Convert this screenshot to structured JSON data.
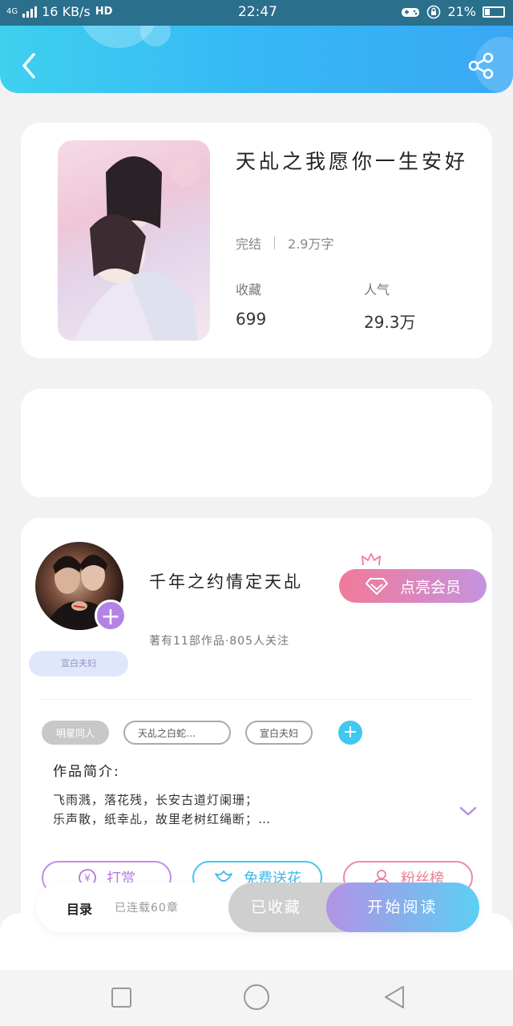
{
  "status_bar": {
    "network": "4G",
    "speed": "16 KB/s",
    "hd": "HD",
    "time": "22:47",
    "battery": "21%"
  },
  "header": {
    "back_icon": "chevron-left-icon",
    "share_icon": "share-icon"
  },
  "book": {
    "title": "天乩之我愿你一生安好",
    "status": "完结",
    "word_count": "2.9万字",
    "favorites_label": "收藏",
    "favorites_value": "699",
    "popularity_label": "人气",
    "popularity_value": "29.3万"
  },
  "author": {
    "name": "千年之约情定天乩",
    "tag": "宣白夫妇",
    "meta": "著有11部作品·805人关注",
    "vip_label": "点亮会员"
  },
  "tags": [
    {
      "label": "明星同人"
    },
    {
      "label": "天乩之白蛇…"
    },
    {
      "label": "宣白夫妇"
    }
  ],
  "intro": {
    "label": "作品简介:",
    "line1": "飞雨溅，落花残，长安古道灯阑珊；",
    "line2": "乐声散，纸幸乩，故里老树红绳断；…"
  },
  "actions": {
    "reward": "打赏",
    "flower": "免费送花",
    "fans": "粉丝榜"
  },
  "bottom": {
    "toc": "目录",
    "serial": "已连载60章",
    "collected": "已收藏",
    "read": "开始阅读"
  },
  "colors": {
    "header_gradient_start": "#3ed0ef",
    "header_gradient_end": "#3aa7f4",
    "vip_start": "#f27a98",
    "vip_end": "#c593e0",
    "accent_cyan": "#41c8ef",
    "accent_purple": "#b482e4"
  }
}
